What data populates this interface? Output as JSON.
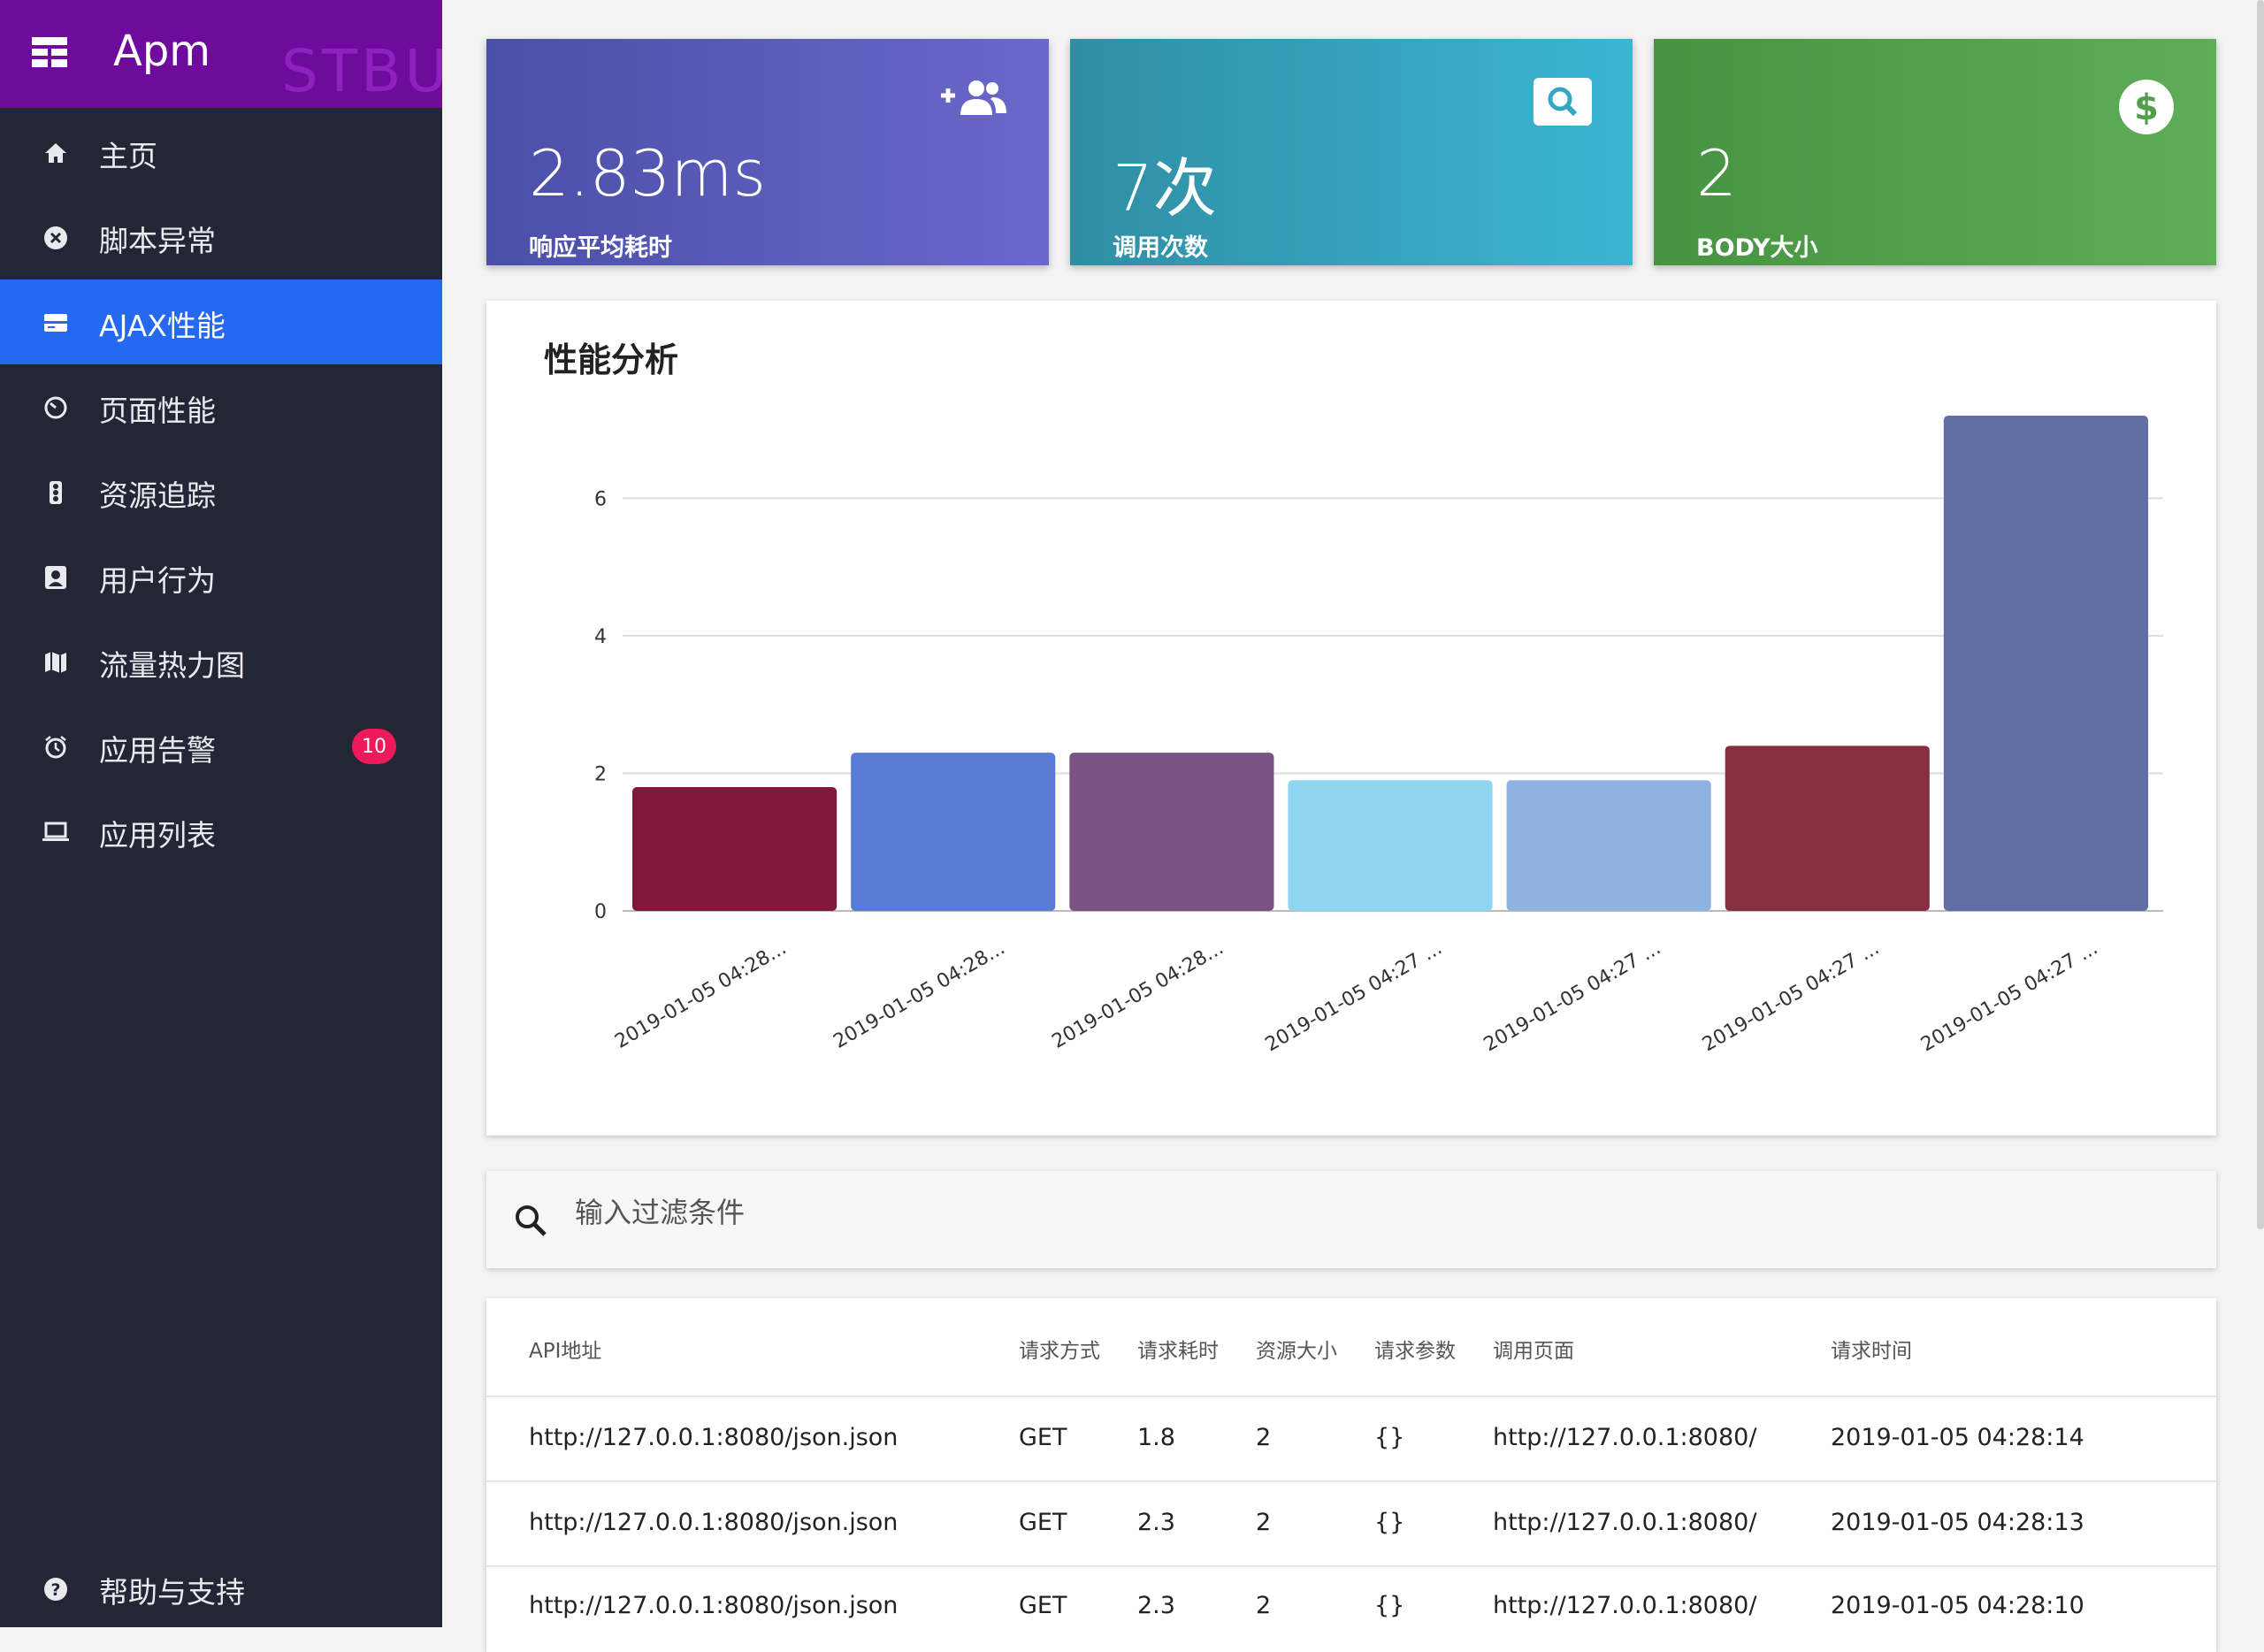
{
  "app": {
    "title": "Apm",
    "watermark": "STBUI"
  },
  "sidebar": {
    "items": [
      {
        "label": "主页",
        "icon": "home-icon"
      },
      {
        "label": "脚本异常",
        "icon": "error-circle-icon"
      },
      {
        "label": "AJAX性能",
        "icon": "card-icon"
      },
      {
        "label": "页面性能",
        "icon": "timer-icon"
      },
      {
        "label": "资源追踪",
        "icon": "traffic-icon"
      },
      {
        "label": "用户行为",
        "icon": "account-box-icon"
      },
      {
        "label": "流量热力图",
        "icon": "map-icon"
      },
      {
        "label": "应用告警",
        "icon": "alarm-icon",
        "badge": "10"
      },
      {
        "label": "应用列表",
        "icon": "laptop-icon"
      }
    ],
    "help": {
      "label": "帮助与支持",
      "icon": "help-icon"
    },
    "active_index": 2
  },
  "stats": [
    {
      "value": "2.83ms",
      "label": "响应平均耗时",
      "icon": "add-group-icon"
    },
    {
      "value": "7次",
      "label": "调用次数",
      "icon": "search-icon"
    },
    {
      "value": "2",
      "label": "BODY大小",
      "icon": "dollar-icon"
    }
  ],
  "colors": {
    "sidebar_bg": "#232635",
    "brand_bg": "#6e0a9c",
    "active_bg": "#2469f0",
    "badge": "#ee1a5a"
  },
  "chart_data": {
    "type": "bar",
    "title": "性能分析",
    "categories": [
      "2019-01-05 04:28...",
      "2019-01-05 04:28...",
      "2019-01-05 04:28...",
      "2019-01-05 04:27 ...",
      "2019-01-05 04:27 ...",
      "2019-01-05 04:27 ...",
      "2019-01-05 04:27 ..."
    ],
    "values": [
      1.8,
      2.3,
      2.3,
      1.9,
      1.9,
      2.4,
      7.2
    ],
    "colors": [
      "#80183c",
      "#5a7bd5",
      "#7c5183",
      "#8ed5ef",
      "#8fb2e1",
      "#852f40",
      "#626ea6"
    ],
    "yticks": [
      0,
      2,
      4,
      6
    ],
    "ylim": [
      0,
      7.2
    ]
  },
  "search": {
    "placeholder": "输入过滤条件"
  },
  "table": {
    "headers": [
      "API地址",
      "请求方式",
      "请求耗时",
      "资源大小",
      "请求参数",
      "调用页面",
      "请求时间"
    ],
    "rows": [
      [
        "http://127.0.0.1:8080/json.json",
        "GET",
        "1.8",
        "2",
        "{}",
        "http://127.0.0.1:8080/",
        "2019-01-05 04:28:14"
      ],
      [
        "http://127.0.0.1:8080/json.json",
        "GET",
        "2.3",
        "2",
        "{}",
        "http://127.0.0.1:8080/",
        "2019-01-05 04:28:13"
      ],
      [
        "http://127.0.0.1:8080/json.json",
        "GET",
        "2.3",
        "2",
        "{}",
        "http://127.0.0.1:8080/",
        "2019-01-05 04:28:10"
      ]
    ]
  }
}
